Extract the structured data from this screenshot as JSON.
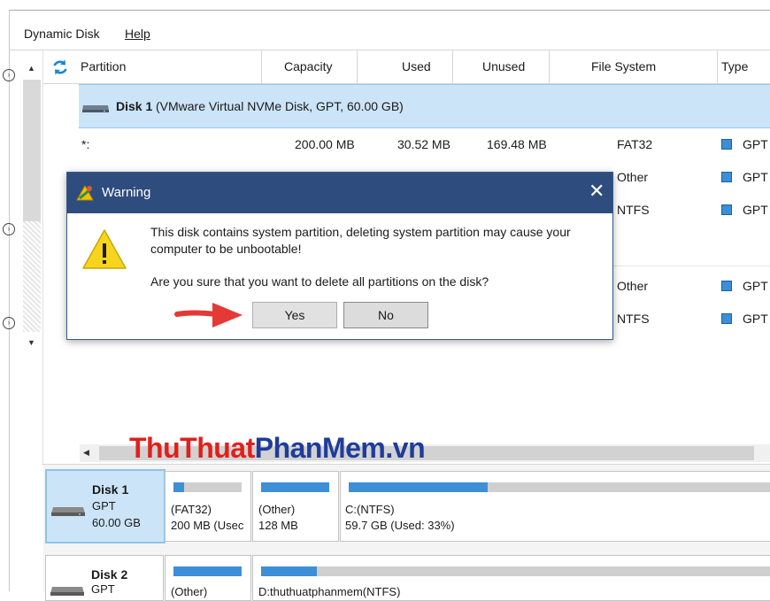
{
  "menu": {
    "items": [
      "Dynamic Disk",
      "Help"
    ]
  },
  "table": {
    "headers": {
      "partition": "Partition",
      "capacity": "Capacity",
      "used": "Used",
      "unused": "Unused",
      "filesystem": "File System",
      "type": "Type"
    },
    "disk1_label": "Disk 1",
    "disk1_desc": "(VMware Virtual NVMe Disk, GPT, 60.00 GB)",
    "rows": [
      {
        "partition": "*:",
        "capacity": "200.00 MB",
        "used": "30.52 MB",
        "unused": "169.48 MB",
        "filesystem": "FAT32",
        "type": "GPT"
      },
      {
        "filesystem": "Other",
        "type": "GPT"
      },
      {
        "filesystem": "NTFS",
        "type": "GPT"
      },
      {
        "filesystem": "Other",
        "type": "GPT"
      },
      {
        "filesystem": "NTFS",
        "type": "GPT"
      }
    ]
  },
  "dialog": {
    "title": "Warning",
    "message_line1": "This disk contains system partition, deleting system partition may cause your",
    "message_line2": "computer to be unbootable!",
    "question": "Are you sure that you want to delete all partitions on the disk?",
    "yes": "Yes",
    "no": "No"
  },
  "watermark": {
    "part1": "Thu",
    "part2": "Thuat",
    "part3": "Phan",
    "part4": "Mem",
    "part5": ".vn"
  },
  "disk_map": {
    "disk1": {
      "name": "Disk 1",
      "style": "GPT",
      "size": "60.00 GB",
      "partitions": [
        {
          "label": "(FAT32)",
          "detail": "200 MB (Usec",
          "used_fraction": 0.15
        },
        {
          "label": "(Other)",
          "detail": "128 MB",
          "used_fraction": 1.0
        },
        {
          "label": "C:(NTFS)",
          "detail": "59.7 GB (Used: 33%)",
          "used_fraction": 0.33
        }
      ]
    },
    "disk2": {
      "name": "Disk 2",
      "style": "GPT",
      "partitions": [
        {
          "label": "(Other)",
          "used_fraction": 1.0
        },
        {
          "label": "D:thuthuatphanmem(NTFS)",
          "used_fraction": 0.11
        }
      ]
    }
  },
  "colors": {
    "accent": "#3d8fd6",
    "title_bar": "#2f4c7e",
    "selection": "#cce4f7",
    "arrow": "#e53935"
  }
}
